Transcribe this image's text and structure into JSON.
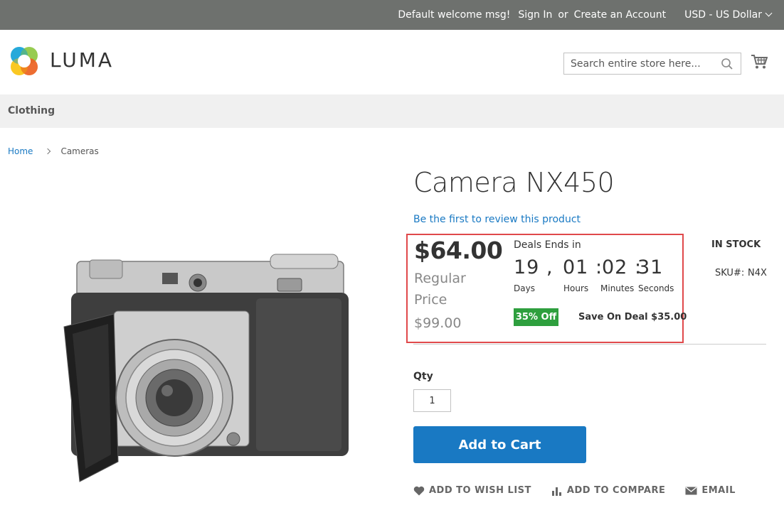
{
  "topbar": {
    "welcome": "Default welcome msg!",
    "sign_in": "Sign In",
    "or": "or",
    "create_account": "Create an Account",
    "currency": "USD - US Dollar"
  },
  "header": {
    "logo_text": "LUMA",
    "search_placeholder": "Search entire store here...",
    "icons": [
      "luma-logo-icon",
      "search-icon",
      "cart-icon"
    ]
  },
  "nav": {
    "items": [
      "Clothing"
    ]
  },
  "breadcrumb": {
    "home": "Home",
    "current": "Cameras"
  },
  "product": {
    "title": "Camera NX450",
    "review_link": "Be the first to review this product",
    "price": "$64.00",
    "regular_label_line1": "Regular",
    "regular_label_line2": "Price",
    "regular_price": "$99.00",
    "deal": {
      "label": "Deals Ends in",
      "days": "19",
      "hours": "01",
      "minutes": "02",
      "seconds": "31",
      "days_label": "Days",
      "hours_label": "Hours",
      "minutes_label": "Minutes",
      "seconds_label": "Seconds",
      "off_badge": "35% Off",
      "save_text": "Save On Deal $35.00"
    },
    "stock": "IN STOCK",
    "sku_label": "SKU#:",
    "sku_value": "N4X",
    "qty_label": "Qty",
    "qty_value": "1",
    "add_to_cart": "Add to Cart",
    "actions": {
      "wishlist": "ADD TO WISH LIST",
      "compare": "ADD TO COMPARE",
      "email": "EMAIL"
    }
  },
  "colors": {
    "topbar_bg": "#6e716e",
    "link": "#1979c3",
    "button": "#1979c3",
    "highlight_border": "#e0494b",
    "badge_green": "#2e9f3e"
  }
}
